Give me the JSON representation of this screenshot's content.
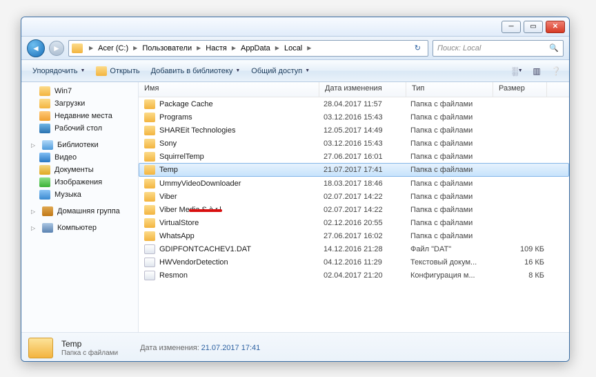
{
  "search": {
    "placeholder": "Поиск: Local"
  },
  "breadcrumb": [
    "Acer (C:)",
    "Пользователи",
    "Настя",
    "AppData",
    "Local"
  ],
  "toolbar": {
    "organize": "Упорядочить",
    "open": "Открыть",
    "add_library": "Добавить в библиотеку",
    "share": "Общий доступ"
  },
  "nav": {
    "win7": "Win7",
    "downloads": "Загрузки",
    "recent": "Недавние места",
    "desktop": "Рабочий стол",
    "libraries": "Библиотеки",
    "video": "Видео",
    "documents": "Документы",
    "pictures": "Изображения",
    "music": "Музыка",
    "homegroup": "Домашняя группа",
    "computer": "Компьютер"
  },
  "columns": {
    "name": "Имя",
    "date": "Дата изменения",
    "type": "Тип",
    "size": "Размер"
  },
  "typestr": {
    "folder": "Папка с файлами",
    "dat": "Файл \"DAT\"",
    "txt": "Текстовый докум...",
    "cfg": "Конфигурация м..."
  },
  "files": [
    {
      "name": "Package Cache",
      "date": "28.04.2017 11:57",
      "type": "folder",
      "size": ""
    },
    {
      "name": "Programs",
      "date": "03.12.2016 15:43",
      "type": "folder",
      "size": ""
    },
    {
      "name": "SHAREit Technologies",
      "date": "12.05.2017 14:49",
      "type": "folder",
      "size": ""
    },
    {
      "name": "Sony",
      "date": "03.12.2016 15:43",
      "type": "folder",
      "size": ""
    },
    {
      "name": "SquirrelTemp",
      "date": "27.06.2017 16:01",
      "type": "folder",
      "size": ""
    },
    {
      "name": "Temp",
      "date": "21.07.2017 17:41",
      "type": "folder",
      "size": "",
      "selected": true
    },
    {
      "name": "UmmyVideoDownloader",
      "date": "18.03.2017 18:46",
      "type": "folder",
      "size": ""
    },
    {
      "name": "Viber",
      "date": "02.07.2017 14:22",
      "type": "folder",
      "size": ""
    },
    {
      "name": "Viber Media S.à r.l",
      "date": "02.07.2017 14:22",
      "type": "folder",
      "size": ""
    },
    {
      "name": "VirtualStore",
      "date": "02.12.2016 20:55",
      "type": "folder",
      "size": ""
    },
    {
      "name": "WhatsApp",
      "date": "27.06.2017 16:02",
      "type": "folder",
      "size": ""
    },
    {
      "name": "GDIPFONTCACHEV1.DAT",
      "date": "14.12.2016 21:28",
      "type": "dat",
      "size": "109 КБ"
    },
    {
      "name": "HWVendorDetection",
      "date": "04.12.2016 11:29",
      "type": "txt",
      "size": "16 КБ"
    },
    {
      "name": "Resmon",
      "date": "02.04.2017 21:20",
      "type": "cfg",
      "size": "8 КБ"
    }
  ],
  "details": {
    "name": "Temp",
    "type": "Папка с файлами",
    "date_label": "Дата изменения:",
    "date": "21.07.2017 17:41"
  }
}
